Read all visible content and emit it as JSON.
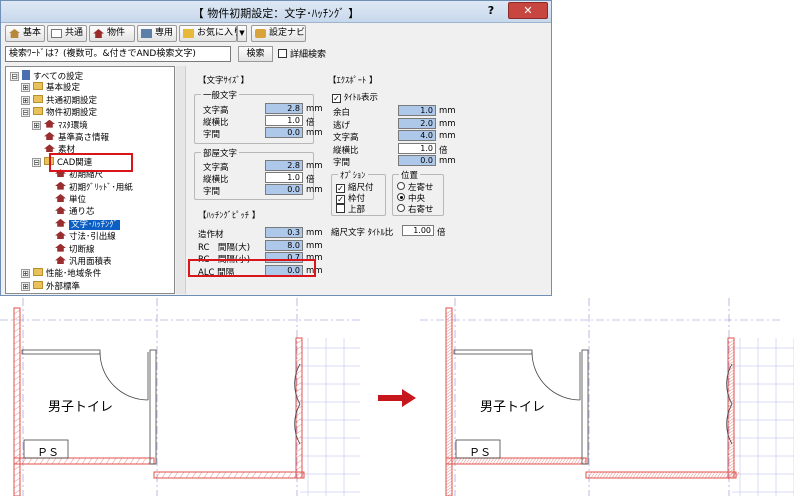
{
  "dialog": {
    "title": "【 物件初期設定：文字･ﾊｯﾁﾝｸﾞ 】",
    "help": "?",
    "close": "✕"
  },
  "toolbar": {
    "basic": "基本",
    "common": "共通",
    "property": "物件",
    "dedicated": "専用",
    "favorites": "お気に入り",
    "dropdown": "▼",
    "navi": "設定ナビ"
  },
  "search": {
    "value": "検索ﾜｰﾄﾞは？(複数可。&付きでAND検索文字)",
    "button": "検索",
    "detail_label": "詳細検索"
  },
  "tree": [
    {
      "label": "すべての設定",
      "exp": "⊟",
      "icon": "book",
      "indent": 0
    },
    {
      "label": "基本設定",
      "exp": "⊞",
      "icon": "folder",
      "indent": 1
    },
    {
      "label": "共通初期設定",
      "exp": "⊞",
      "icon": "folder",
      "indent": 1
    },
    {
      "label": "物件初期設定",
      "exp": "⊟",
      "icon": "folder",
      "indent": 1
    },
    {
      "label": "ﾏｽﾀ環境",
      "exp": "⊞",
      "icon": "house",
      "indent": 2
    },
    {
      "label": "基準高さ情報",
      "exp": "",
      "icon": "house",
      "indent": 2
    },
    {
      "label": "素材",
      "exp": "",
      "icon": "house",
      "indent": 2
    },
    {
      "label": "CAD関連",
      "exp": "⊟",
      "icon": "folder",
      "indent": 2
    },
    {
      "label": "初期縮尺",
      "exp": "",
      "icon": "house",
      "indent": 3
    },
    {
      "label": "初期ｸﾞﾘｯﾄﾞ･用紙",
      "exp": "",
      "icon": "house",
      "indent": 3
    },
    {
      "label": "単位",
      "exp": "",
      "icon": "house",
      "indent": 3
    },
    {
      "label": "通り芯",
      "exp": "",
      "icon": "house",
      "indent": 3
    },
    {
      "label": "文字･ﾊｯﾁﾝｸﾞ",
      "exp": "",
      "icon": "house",
      "indent": 3,
      "selected": true
    },
    {
      "label": "寸法･引出線",
      "exp": "",
      "icon": "house",
      "indent": 3
    },
    {
      "label": "切断線",
      "exp": "",
      "icon": "house",
      "indent": 3
    },
    {
      "label": "汎用面積表",
      "exp": "",
      "icon": "house",
      "indent": 3
    },
    {
      "label": "性能･地域条件",
      "exp": "⊞",
      "icon": "folder",
      "indent": 1
    },
    {
      "label": "外部標準",
      "exp": "⊞",
      "icon": "folder",
      "indent": 1
    }
  ],
  "text_size": {
    "title": "【文字ｻｲｽﾞ】",
    "general": {
      "title": "一般文字",
      "rows": [
        {
          "label": "文字高",
          "value": "2.8",
          "unit": "mm",
          "bg": "blue"
        },
        {
          "label": "縦横比",
          "value": "1.0",
          "unit": "倍",
          "bg": "white"
        },
        {
          "label": "字間",
          "value": "0.0",
          "unit": "mm",
          "bg": "blue"
        }
      ]
    },
    "room": {
      "title": "部屋文字",
      "rows": [
        {
          "label": "文字高",
          "value": "2.8",
          "unit": "mm",
          "bg": "blue"
        },
        {
          "label": "縦横比",
          "value": "1.0",
          "unit": "倍",
          "bg": "white"
        },
        {
          "label": "字間",
          "value": "0.0",
          "unit": "mm",
          "bg": "blue"
        }
      ]
    }
  },
  "hatching": {
    "title": "【ﾊｯﾁﾝｸﾞﾋﾟｯﾁ 】",
    "rows": [
      {
        "label": "造作材",
        "value": "0.3",
        "unit": "mm"
      },
      {
        "label": "RC　間隔(大)",
        "value": "8.0",
        "unit": "mm"
      },
      {
        "label": "RC　間隔(小)",
        "value": "0.7",
        "unit": "mm"
      },
      {
        "label": "ALC 間隔",
        "value": "0.0",
        "unit": "mm"
      }
    ]
  },
  "export": {
    "title": "【ｴｸｽﾎﾟｰﾄ 】",
    "title_display_label": "ﾀｲﾄﾙ表示",
    "title_display_checked": "✓",
    "rows": [
      {
        "label": "余白",
        "value": "1.0",
        "unit": "mm",
        "bg": "blue"
      },
      {
        "label": "逃げ",
        "value": "2.0",
        "unit": "mm",
        "bg": "blue"
      },
      {
        "label": "文字高",
        "value": "4.0",
        "unit": "mm",
        "bg": "blue"
      },
      {
        "label": "縦横比",
        "value": "1.0",
        "unit": "倍",
        "bg": "white"
      },
      {
        "label": "字間",
        "value": "0.0",
        "unit": "mm",
        "bg": "blue"
      }
    ],
    "options": {
      "title": "ｵﾌﾟｼｮﾝ",
      "items": [
        {
          "label": "縮尺付",
          "checked": "✓"
        },
        {
          "label": "枠付",
          "checked": "✓"
        },
        {
          "label": "上部",
          "checked": ""
        }
      ]
    },
    "position": {
      "title": "位置",
      "items": [
        {
          "label": "左寄せ",
          "on": false
        },
        {
          "label": "中央",
          "on": true
        },
        {
          "label": "右寄せ",
          "on": false
        }
      ]
    },
    "scale_ratio_label": "縮尺文字 ﾀｲﾄﾙ比",
    "scale_ratio_value": "1.00",
    "scale_ratio_unit": "倍"
  },
  "plan": {
    "room_label": "男子トイレ",
    "ps_label": "ＰＳ",
    "colors": {
      "wall": "#e0524b",
      "grid": "#8c8cd8",
      "hatch": "#e0524b"
    }
  },
  "colors": {
    "highlight": "#d9141a",
    "arrow": "#c8161d",
    "selection": "#0a5ec4"
  }
}
